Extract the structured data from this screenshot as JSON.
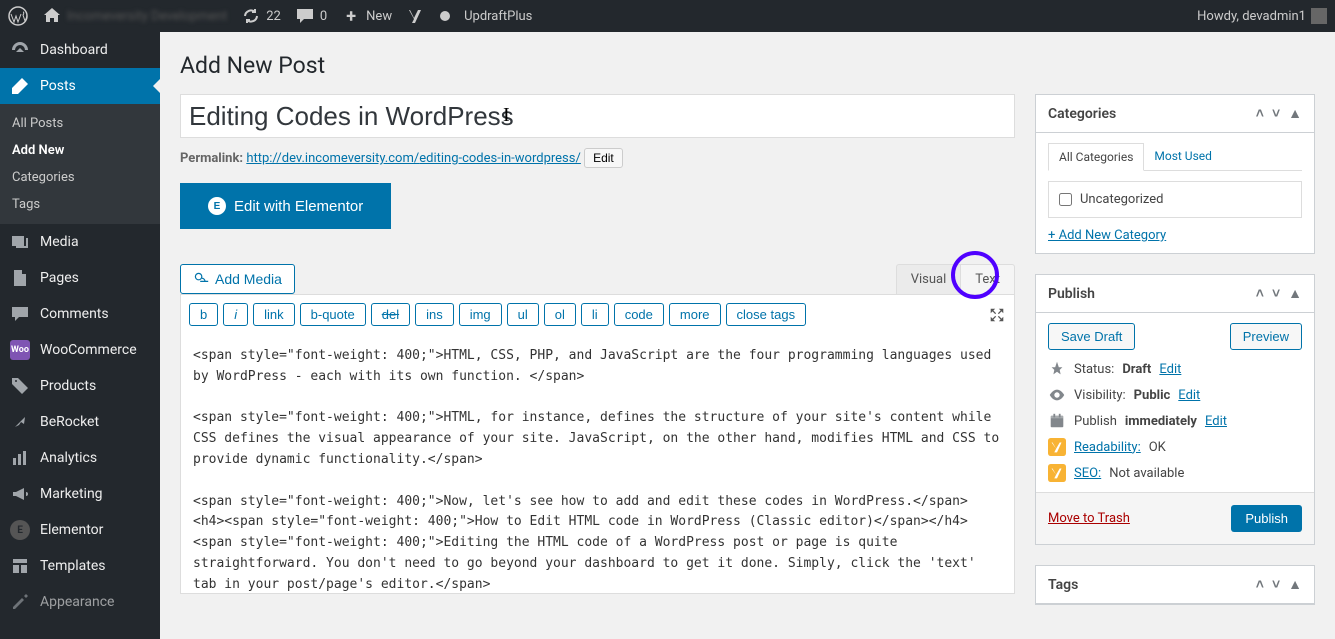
{
  "adminbar": {
    "site_name": "Incomeversity Development",
    "updates": "22",
    "comments": "0",
    "new": "New",
    "updraft": "UpdraftPlus",
    "howdy": "Howdy, devadmin1"
  },
  "sidebar": {
    "dashboard": "Dashboard",
    "posts": "Posts",
    "posts_sub": {
      "all": "All Posts",
      "add": "Add New",
      "cats": "Categories",
      "tags": "Tags"
    },
    "media": "Media",
    "pages": "Pages",
    "comments": "Comments",
    "woo": "WooCommerce",
    "products": "Products",
    "berocket": "BeRocket",
    "analytics": "Analytics",
    "marketing": "Marketing",
    "elementor": "Elementor",
    "templates": "Templates",
    "appearance": "Appearance"
  },
  "page": {
    "heading": "Add New Post",
    "title_value": "Editing Codes in WordPress",
    "permalink_label": "Permalink:",
    "permalink_base": "http://dev.incomeversity.com/",
    "permalink_slug": "editing-codes-in-wordpress/",
    "edit_btn": "Edit",
    "elementor_btn": "Edit with Elementor",
    "add_media": "Add Media",
    "tabs": {
      "visual": "Visual",
      "text": "Text"
    },
    "quicktags": [
      "b",
      "i",
      "link",
      "b-quote",
      "del",
      "ins",
      "img",
      "ul",
      "ol",
      "li",
      "code",
      "more",
      "close tags"
    ],
    "content": "<span style=\"font-weight: 400;\">HTML, CSS, PHP, and JavaScript are the four programming languages used by WordPress - each with its own function. </span>\n\n<span style=\"font-weight: 400;\">HTML, for instance, defines the structure of your site's content while CSS defines the visual appearance of your site. JavaScript, on the other hand, modifies HTML and CSS to provide dynamic functionality.</span>\n\n<span style=\"font-weight: 400;\">Now, let's see how to add and edit these codes in WordPress.</span>\n<h4><span style=\"font-weight: 400;\">How to Edit HTML code in WordPress (Classic editor)</span></h4>\n<span style=\"font-weight: 400;\">Editing the HTML code of a WordPress post or page is quite straightforward. You don't need to go beyond your dashboard to get it done. Simply, click the 'text' tab in your post/page's editor.</span>"
  },
  "categories": {
    "title": "Categories",
    "tab_all": "All Categories",
    "tab_most": "Most Used",
    "uncat": "Uncategorized",
    "add_new": "+ Add New Category"
  },
  "publish": {
    "title": "Publish",
    "save_draft": "Save Draft",
    "preview": "Preview",
    "status_label": "Status:",
    "status_value": "Draft",
    "visibility_label": "Visibility:",
    "visibility_value": "Public",
    "schedule_label": "Publish",
    "schedule_value": "immediately",
    "edit": "Edit",
    "readability_label": "Readability:",
    "readability_value": "OK",
    "seo_label": "SEO:",
    "seo_value": "Not available",
    "trash": "Move to Trash",
    "publish_btn": "Publish"
  },
  "tags": {
    "title": "Tags"
  }
}
